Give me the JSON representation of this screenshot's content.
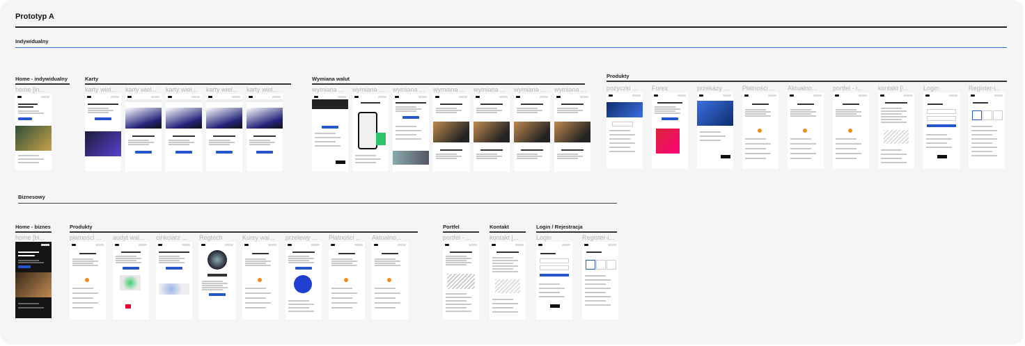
{
  "title": "Prototyp A",
  "sections": {
    "individual": "Indywidualny",
    "business": "Biznesowy"
  },
  "groups": [
    {
      "label": "Home - indywidualny",
      "frames": [
        {
          "name": "home [in..."
        }
      ]
    },
    {
      "label": "Karty",
      "frames": [
        {
          "name": "karty wiel..."
        },
        {
          "name": "karty wiel..."
        },
        {
          "name": "karty wiel..."
        },
        {
          "name": "karty wiel..."
        },
        {
          "name": "karty wiel..."
        }
      ]
    },
    {
      "label": "Wymiana walut",
      "frames": [
        {
          "name": "wymiana ..."
        },
        {
          "name": "wymiana ..."
        },
        {
          "name": "wymiana ..."
        },
        {
          "name": "wymiana ..."
        },
        {
          "name": "wymiana ..."
        },
        {
          "name": "wymiana ..."
        },
        {
          "name": "wymiana ..."
        }
      ]
    },
    {
      "label": "Produkty",
      "frames": [
        {
          "name": "pożyczki ..."
        },
        {
          "name": "Forex"
        },
        {
          "name": "przekazy ..."
        },
        {
          "name": "Płatności ..."
        },
        {
          "name": "Aktualno..."
        },
        {
          "name": "portfel - i..."
        },
        {
          "name": "kontakt [i..."
        },
        {
          "name": "Login"
        },
        {
          "name": "Register-i..."
        }
      ]
    },
    {
      "label": "Home - biznes",
      "frames": [
        {
          "name": "home [bi..."
        }
      ]
    },
    {
      "label": "Produkty",
      "frames": [
        {
          "name": "płatności ..."
        },
        {
          "name": "audyt wal..."
        },
        {
          "name": "cinkciarz ..."
        },
        {
          "name": "Regtech"
        },
        {
          "name": "Kursy wal..."
        },
        {
          "name": "przelewy ..."
        },
        {
          "name": "Płatności ..."
        },
        {
          "name": "Aktualno..."
        }
      ]
    },
    {
      "label": "Portfel",
      "frames": [
        {
          "name": "portfel - ..."
        }
      ]
    },
    {
      "label": "Kontakt",
      "frames": [
        {
          "name": "kontakt [..."
        }
      ]
    },
    {
      "label": "Login / Rejestracja",
      "frames": [
        {
          "name": "Login"
        },
        {
          "name": "Register-i..."
        }
      ]
    }
  ]
}
